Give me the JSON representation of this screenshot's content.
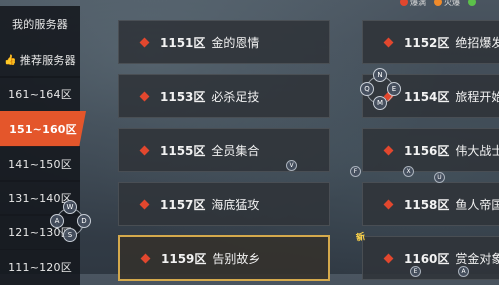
{
  "top_legend": [
    {
      "label": "爆满",
      "color": "#e2472e"
    },
    {
      "label": "火爆",
      "color": "#f08a2a"
    },
    {
      "label": "",
      "color": "#5cc04a"
    }
  ],
  "sidebar": {
    "items": [
      {
        "label": "我的服务器",
        "icon": ""
      },
      {
        "label": "推荐服务器",
        "icon": "👍"
      },
      {
        "label": "161~164区",
        "icon": ""
      },
      {
        "label": "151~160区",
        "icon": ""
      },
      {
        "label": "141~150区",
        "icon": ""
      },
      {
        "label": "131~140区",
        "icon": ""
      },
      {
        "label": "121~130区",
        "icon": ""
      },
      {
        "label": "111~120区",
        "icon": ""
      }
    ],
    "active_index": 3
  },
  "servers": [
    {
      "num": "1151区",
      "name": "金的恩情"
    },
    {
      "num": "1152区",
      "name": "绝招爆发"
    },
    {
      "num": "1153区",
      "name": "必杀足技"
    },
    {
      "num": "1154区",
      "name": "旅程开始"
    },
    {
      "num": "1155区",
      "name": "全员集合"
    },
    {
      "num": "1156区",
      "name": "伟大战士"
    },
    {
      "num": "1157区",
      "name": "海底猛攻"
    },
    {
      "num": "1158区",
      "name": "鱼人帝国"
    },
    {
      "num": "1159区",
      "name": "告别故乡"
    },
    {
      "num": "1160区",
      "name": "赏金对象"
    }
  ],
  "new_badge": "新",
  "pad_right": {
    "up": "N",
    "left": "Q",
    "right": "E",
    "down": "M"
  },
  "pad_left": {
    "up": "W",
    "left": "A",
    "right": "D",
    "down": "S"
  },
  "mini_buttons": [
    "V",
    "F",
    "X",
    "U",
    "E",
    "A"
  ]
}
